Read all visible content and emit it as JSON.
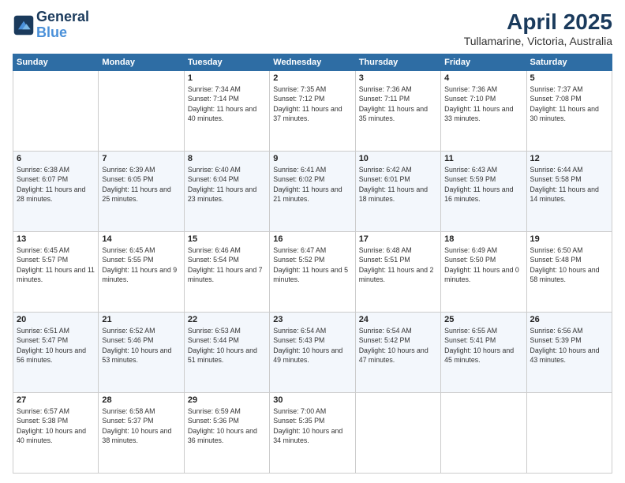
{
  "header": {
    "logo_line1": "General",
    "logo_line2": "Blue",
    "main_title": "April 2025",
    "subtitle": "Tullamarine, Victoria, Australia"
  },
  "columns": [
    "Sunday",
    "Monday",
    "Tuesday",
    "Wednesday",
    "Thursday",
    "Friday",
    "Saturday"
  ],
  "weeks": [
    [
      {
        "day": "",
        "sunrise": "",
        "sunset": "",
        "daylight": ""
      },
      {
        "day": "",
        "sunrise": "",
        "sunset": "",
        "daylight": ""
      },
      {
        "day": "1",
        "sunrise": "Sunrise: 7:34 AM",
        "sunset": "Sunset: 7:14 PM",
        "daylight": "Daylight: 11 hours and 40 minutes."
      },
      {
        "day": "2",
        "sunrise": "Sunrise: 7:35 AM",
        "sunset": "Sunset: 7:12 PM",
        "daylight": "Daylight: 11 hours and 37 minutes."
      },
      {
        "day": "3",
        "sunrise": "Sunrise: 7:36 AM",
        "sunset": "Sunset: 7:11 PM",
        "daylight": "Daylight: 11 hours and 35 minutes."
      },
      {
        "day": "4",
        "sunrise": "Sunrise: 7:36 AM",
        "sunset": "Sunset: 7:10 PM",
        "daylight": "Daylight: 11 hours and 33 minutes."
      },
      {
        "day": "5",
        "sunrise": "Sunrise: 7:37 AM",
        "sunset": "Sunset: 7:08 PM",
        "daylight": "Daylight: 11 hours and 30 minutes."
      }
    ],
    [
      {
        "day": "6",
        "sunrise": "Sunrise: 6:38 AM",
        "sunset": "Sunset: 6:07 PM",
        "daylight": "Daylight: 11 hours and 28 minutes."
      },
      {
        "day": "7",
        "sunrise": "Sunrise: 6:39 AM",
        "sunset": "Sunset: 6:05 PM",
        "daylight": "Daylight: 11 hours and 25 minutes."
      },
      {
        "day": "8",
        "sunrise": "Sunrise: 6:40 AM",
        "sunset": "Sunset: 6:04 PM",
        "daylight": "Daylight: 11 hours and 23 minutes."
      },
      {
        "day": "9",
        "sunrise": "Sunrise: 6:41 AM",
        "sunset": "Sunset: 6:02 PM",
        "daylight": "Daylight: 11 hours and 21 minutes."
      },
      {
        "day": "10",
        "sunrise": "Sunrise: 6:42 AM",
        "sunset": "Sunset: 6:01 PM",
        "daylight": "Daylight: 11 hours and 18 minutes."
      },
      {
        "day": "11",
        "sunrise": "Sunrise: 6:43 AM",
        "sunset": "Sunset: 5:59 PM",
        "daylight": "Daylight: 11 hours and 16 minutes."
      },
      {
        "day": "12",
        "sunrise": "Sunrise: 6:44 AM",
        "sunset": "Sunset: 5:58 PM",
        "daylight": "Daylight: 11 hours and 14 minutes."
      }
    ],
    [
      {
        "day": "13",
        "sunrise": "Sunrise: 6:45 AM",
        "sunset": "Sunset: 5:57 PM",
        "daylight": "Daylight: 11 hours and 11 minutes."
      },
      {
        "day": "14",
        "sunrise": "Sunrise: 6:45 AM",
        "sunset": "Sunset: 5:55 PM",
        "daylight": "Daylight: 11 hours and 9 minutes."
      },
      {
        "day": "15",
        "sunrise": "Sunrise: 6:46 AM",
        "sunset": "Sunset: 5:54 PM",
        "daylight": "Daylight: 11 hours and 7 minutes."
      },
      {
        "day": "16",
        "sunrise": "Sunrise: 6:47 AM",
        "sunset": "Sunset: 5:52 PM",
        "daylight": "Daylight: 11 hours and 5 minutes."
      },
      {
        "day": "17",
        "sunrise": "Sunrise: 6:48 AM",
        "sunset": "Sunset: 5:51 PM",
        "daylight": "Daylight: 11 hours and 2 minutes."
      },
      {
        "day": "18",
        "sunrise": "Sunrise: 6:49 AM",
        "sunset": "Sunset: 5:50 PM",
        "daylight": "Daylight: 11 hours and 0 minutes."
      },
      {
        "day": "19",
        "sunrise": "Sunrise: 6:50 AM",
        "sunset": "Sunset: 5:48 PM",
        "daylight": "Daylight: 10 hours and 58 minutes."
      }
    ],
    [
      {
        "day": "20",
        "sunrise": "Sunrise: 6:51 AM",
        "sunset": "Sunset: 5:47 PM",
        "daylight": "Daylight: 10 hours and 56 minutes."
      },
      {
        "day": "21",
        "sunrise": "Sunrise: 6:52 AM",
        "sunset": "Sunset: 5:46 PM",
        "daylight": "Daylight: 10 hours and 53 minutes."
      },
      {
        "day": "22",
        "sunrise": "Sunrise: 6:53 AM",
        "sunset": "Sunset: 5:44 PM",
        "daylight": "Daylight: 10 hours and 51 minutes."
      },
      {
        "day": "23",
        "sunrise": "Sunrise: 6:54 AM",
        "sunset": "Sunset: 5:43 PM",
        "daylight": "Daylight: 10 hours and 49 minutes."
      },
      {
        "day": "24",
        "sunrise": "Sunrise: 6:54 AM",
        "sunset": "Sunset: 5:42 PM",
        "daylight": "Daylight: 10 hours and 47 minutes."
      },
      {
        "day": "25",
        "sunrise": "Sunrise: 6:55 AM",
        "sunset": "Sunset: 5:41 PM",
        "daylight": "Daylight: 10 hours and 45 minutes."
      },
      {
        "day": "26",
        "sunrise": "Sunrise: 6:56 AM",
        "sunset": "Sunset: 5:39 PM",
        "daylight": "Daylight: 10 hours and 43 minutes."
      }
    ],
    [
      {
        "day": "27",
        "sunrise": "Sunrise: 6:57 AM",
        "sunset": "Sunset: 5:38 PM",
        "daylight": "Daylight: 10 hours and 40 minutes."
      },
      {
        "day": "28",
        "sunrise": "Sunrise: 6:58 AM",
        "sunset": "Sunset: 5:37 PM",
        "daylight": "Daylight: 10 hours and 38 minutes."
      },
      {
        "day": "29",
        "sunrise": "Sunrise: 6:59 AM",
        "sunset": "Sunset: 5:36 PM",
        "daylight": "Daylight: 10 hours and 36 minutes."
      },
      {
        "day": "30",
        "sunrise": "Sunrise: 7:00 AM",
        "sunset": "Sunset: 5:35 PM",
        "daylight": "Daylight: 10 hours and 34 minutes."
      },
      {
        "day": "",
        "sunrise": "",
        "sunset": "",
        "daylight": ""
      },
      {
        "day": "",
        "sunrise": "",
        "sunset": "",
        "daylight": ""
      },
      {
        "day": "",
        "sunrise": "",
        "sunset": "",
        "daylight": ""
      }
    ]
  ]
}
